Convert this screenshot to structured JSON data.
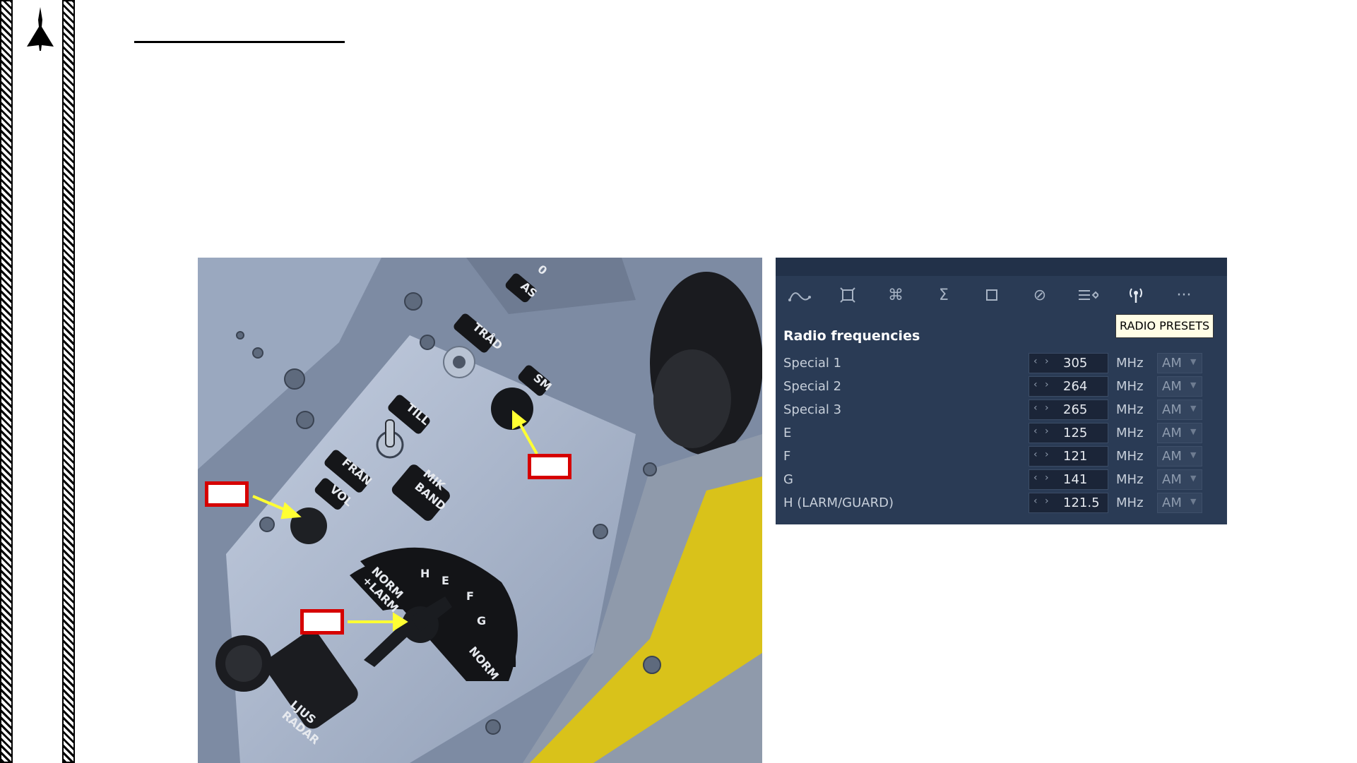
{
  "slide": {
    "title": ""
  },
  "photo": {
    "labels": {
      "trad": "TRÅD",
      "sm": "SM",
      "till": "TILL",
      "fran": "FRÅN",
      "vol": "VOL",
      "mik_band": [
        "MIK",
        "BAND"
      ],
      "norm_larm": [
        "NORM",
        "+LARM"
      ],
      "h": "H",
      "e": "E",
      "f": "F",
      "g": "G",
      "norm": "NORM",
      "ljus_radar": [
        "LJUS",
        "RADAR"
      ],
      "as": "AS",
      "zero": "0"
    }
  },
  "panel": {
    "toolbar": [
      {
        "icon": "route-icon"
      },
      {
        "icon": "target-icon"
      },
      {
        "icon": "command-icon"
      },
      {
        "icon": "sigma-icon",
        "glyph": "Σ"
      },
      {
        "icon": "square-icon",
        "glyph": "☐"
      },
      {
        "icon": "prohibited-icon",
        "glyph": "⊘"
      },
      {
        "icon": "list-icon"
      },
      {
        "icon": "radio-antenna-icon",
        "active": true
      },
      {
        "icon": "more-icon",
        "glyph": "···"
      }
    ],
    "tooltip": "RADIO PRESETS",
    "section_title": "Radio frequencies",
    "rows": [
      {
        "label": "Special 1",
        "value": "305",
        "unit": "MHz",
        "mod": "AM"
      },
      {
        "label": "Special 2",
        "value": "264",
        "unit": "MHz",
        "mod": "AM"
      },
      {
        "label": "Special 3",
        "value": "265",
        "unit": "MHz",
        "mod": "AM"
      },
      {
        "label": "E",
        "value": "125",
        "unit": "MHz",
        "mod": "AM"
      },
      {
        "label": "F",
        "value": "121",
        "unit": "MHz",
        "mod": "AM"
      },
      {
        "label": "G",
        "value": "141",
        "unit": "MHz",
        "mod": "AM"
      },
      {
        "label": "H (LARM/GUARD)",
        "value": "121.5",
        "unit": "MHz",
        "mod": "AM"
      }
    ],
    "arrows": "‹ ›",
    "colors": {
      "background": "#2a3b55",
      "tooltip": "#fffde6"
    }
  },
  "callouts": {
    "border_color": "#d60000",
    "arrow_color": "#ffff33"
  }
}
